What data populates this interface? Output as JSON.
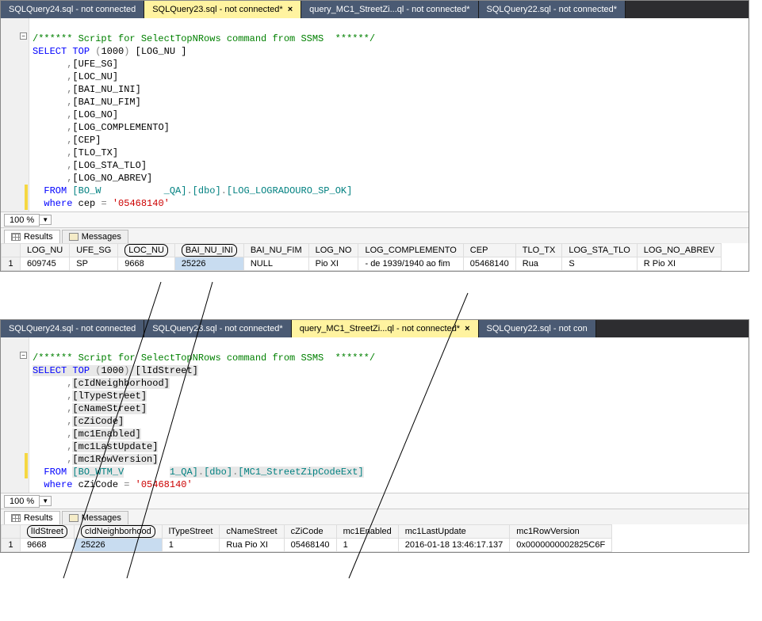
{
  "zoom": "100 %",
  "window1": {
    "tabs": [
      {
        "label": "SQLQuery24.sql - not connected",
        "active": false
      },
      {
        "label": "SQLQuery23.sql - not connected*",
        "active": true,
        "closeable": true
      },
      {
        "label": "query_MC1_StreetZi...ql - not connected*",
        "active": false
      },
      {
        "label": "SQLQuery22.sql - not connected*",
        "active": false
      }
    ],
    "code": {
      "comment": "/****** Script for SelectTopNRows command from SSMS  ******/",
      "select_kw": "SELECT",
      "top_kw": "TOP",
      "top_n": "1000",
      "cols": [
        "[LOG_NU ]",
        "[UFE_SG]",
        "[LOC_NU]",
        "[BAI_NU_INI]",
        "[BAI_NU_FIM]",
        "[LOG_NO]",
        "[LOG_COMPLEMENTO]",
        "[CEP]",
        "[TLO_TX]",
        "[LOG_STA_TLO]",
        "[LOG_NO_ABREV]"
      ],
      "from_kw": "FROM",
      "from_db_prefix": "[BO_W",
      "from_db_mid": "_QA]",
      "from_schema": "[dbo]",
      "from_table": "[LOG_LOGRADOURO_SP_OK]",
      "where_kw": "where",
      "where_col": "cep",
      "where_val": "'05468140'"
    },
    "results": {
      "tab_results": "Results",
      "tab_messages": "Messages",
      "headers": [
        "LOG_NU",
        "UFE_SG",
        "LOC_NU",
        "BAI_NU_INI",
        "BAI_NU_FIM",
        "LOG_NO",
        "LOG_COMPLEMENTO",
        "CEP",
        "TLO_TX",
        "LOG_STA_TLO",
        "LOG_NO_ABREV"
      ],
      "row_num": "1",
      "row": [
        "609745",
        "SP",
        "9668",
        "25226",
        "NULL",
        "Pio XI",
        "- de 1939/1940 ao fim",
        "05468140",
        "Rua",
        "S",
        "R Pio XI"
      ]
    }
  },
  "window2": {
    "tabs": [
      {
        "label": "SQLQuery24.sql - not connected",
        "active": false
      },
      {
        "label": "SQLQuery23.sql - not connected*",
        "active": false
      },
      {
        "label": "query_MC1_StreetZi...ql - not connected*",
        "active": true,
        "closeable": true
      },
      {
        "label": "SQLQuery22.sql - not con",
        "active": false
      }
    ],
    "code": {
      "comment": "/****** Script for SelectTopNRows command from SSMS  ******/",
      "select_kw": "SELECT",
      "top_kw": "TOP",
      "top_n": "1000",
      "cols": [
        "[lIdStreet]",
        "[cIdNeighborhood]",
        "[lTypeStreet]",
        "[cNameStreet]",
        "[cZiCode]",
        "[mc1Enabled]",
        "[mc1LastUpdate]",
        "[mc1RowVersion]"
      ],
      "from_kw": "FROM",
      "from_db_prefix": "[BO_WTM_V",
      "from_db_mid": "1_QA]",
      "from_schema": "[dbo]",
      "from_table": "[MC1_StreetZipCodeExt]",
      "where_kw": "where",
      "where_col": "cZiCode",
      "where_val": "'05468140'"
    },
    "results": {
      "tab_results": "Results",
      "tab_messages": "Messages",
      "headers": [
        "lIdStreet",
        "cIdNeighborhood",
        "lTypeStreet",
        "cNameStreet",
        "cZiCode",
        "mc1Enabled",
        "mc1LastUpdate",
        "mc1RowVersion"
      ],
      "row_num": "1",
      "row": [
        "9668",
        "25226",
        "1",
        "Rua Pio XI",
        "05468140",
        "1",
        "2016-01-18 13:46:17.137",
        "0x0000000002825C6F"
      ]
    }
  }
}
